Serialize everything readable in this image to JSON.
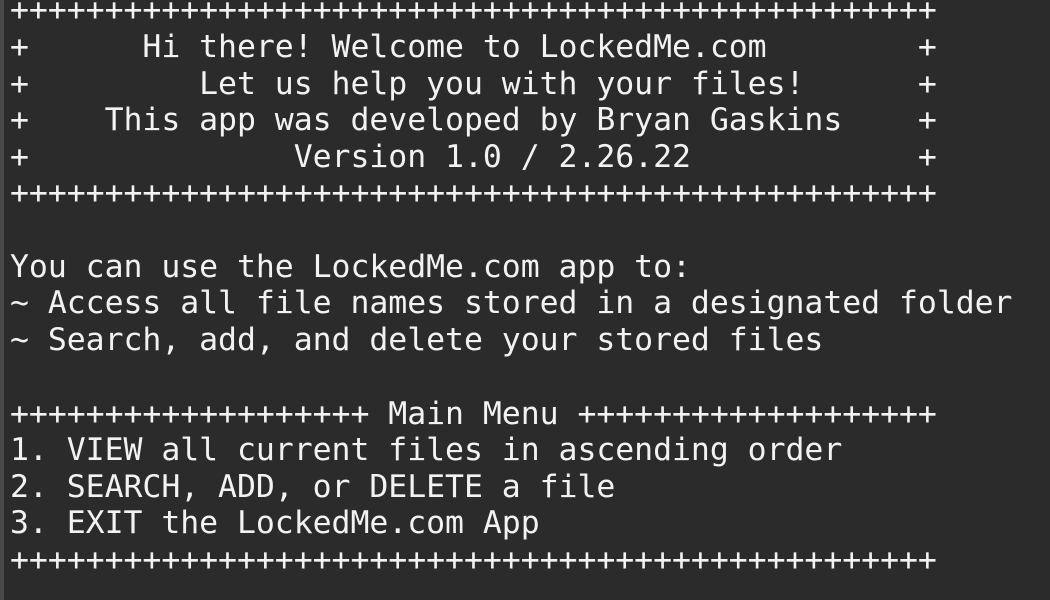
{
  "terminal": {
    "banner_top_border": "+++++++++++++++++++++++++++++++++++++++++++++++++",
    "banner_line_1": "+      Hi there! Welcome to LockedMe.com        +",
    "banner_line_2": "+         Let us help you with your files!      +",
    "banner_line_3": "+    This app was developed by Bryan Gaskins    +",
    "banner_line_4": "+              Version 1.0 / 2.26.22            +",
    "banner_bottom_border": "+++++++++++++++++++++++++++++++++++++++++++++++++",
    "intro": "You can use the LockedMe.com app to:",
    "feature_1": "~ Access all file names stored in a designated folder",
    "feature_2": "~ Search, add, and delete your stored files",
    "menu_header": "+++++++++++++++++++ Main Menu +++++++++++++++++++",
    "menu_option_1": "1. VIEW all current files in ascending order",
    "menu_option_2": "2. SEARCH, ADD, or DELETE a file",
    "menu_option_3": "3. EXIT the LockedMe.com App",
    "menu_footer": "+++++++++++++++++++++++++++++++++++++++++++++++++"
  }
}
